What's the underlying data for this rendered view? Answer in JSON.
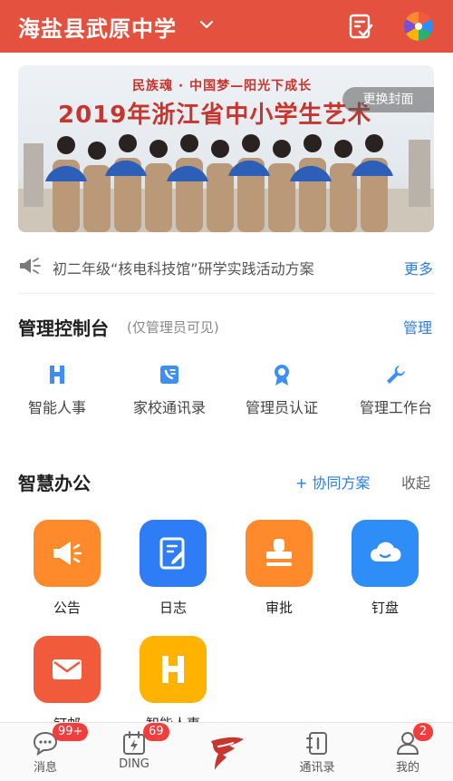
{
  "header": {
    "org_name": "海盐县武原中学",
    "colors": {
      "bar": "#e4523f"
    }
  },
  "banner": {
    "slogan": "民族魂 · 中国梦—阳光下成长",
    "headline": "2019年浙江省中小学生艺术",
    "change_cover_label": "更换封面"
  },
  "notice": {
    "text": "初二年级“核电科技馆”研学实践活动方案",
    "more_label": "更多"
  },
  "admin_console": {
    "title": "管理控制台",
    "note": "(仅管理员可见)",
    "manage_label": "管理",
    "items": [
      {
        "label": "智能人事",
        "icon": "smart-hr-icon"
      },
      {
        "label": "家校通讯录",
        "icon": "contacts-book-icon"
      },
      {
        "label": "管理员认证",
        "icon": "badge-icon"
      },
      {
        "label": "管理工作台",
        "icon": "wrench-icon"
      }
    ]
  },
  "smart_office": {
    "title": "智慧办公",
    "collab_label": "+ 协同方案",
    "collapse_label": "收起",
    "apps": [
      {
        "label": "公告",
        "icon": "megaphone-icon",
        "color": "#ff8a2b"
      },
      {
        "label": "日志",
        "icon": "log-edit-icon",
        "color": "#2e7cf6"
      },
      {
        "label": "审批",
        "icon": "stamp-icon",
        "color": "#ff8a2b"
      },
      {
        "label": "钉盘",
        "icon": "cloud-icon",
        "color": "#2e8df6"
      },
      {
        "label": "钉邮",
        "icon": "mail-icon",
        "color": "#f25a3c"
      },
      {
        "label": "智能人事",
        "icon": "smart-hr-icon",
        "color": "#ffb200"
      }
    ]
  },
  "tabbar": {
    "tabs": [
      {
        "label": "消息",
        "badge": "99+"
      },
      {
        "label": "DING",
        "badge": "69"
      },
      {
        "label": "",
        "badge": ""
      },
      {
        "label": "通讯录",
        "badge": ""
      },
      {
        "label": "我的",
        "badge": "2"
      }
    ]
  }
}
